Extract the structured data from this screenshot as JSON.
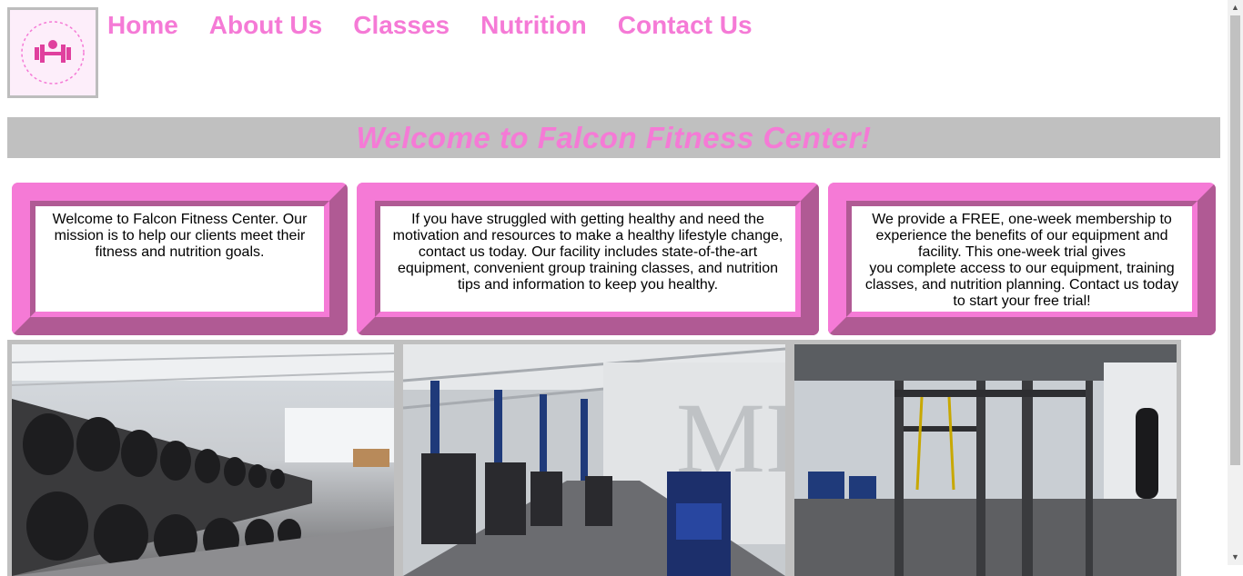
{
  "logo": {
    "alt_text": "FALCON FITNESS CENTER"
  },
  "nav": {
    "items": [
      "Home",
      "About Us",
      "Classes",
      "Nutrition",
      "Contact Us"
    ]
  },
  "banner": {
    "title": "Welcome to Falcon Fitness Center!"
  },
  "boxes": [
    {
      "text": "Welcome to Falcon Fitness Center. Our mission is to help our clients meet their fitness and nutrition goals."
    },
    {
      "text": "If you have struggled with getting healthy and need the motivation and resources to make a healthy lifestyle change, contact us today. Our facility includes state-of-the-art equipment, convenient group training classes, and nutrition tips and information to keep you healthy."
    },
    {
      "text_lines": [
        "We provide a FREE, one-week membership to experience the benefits of our equipment and facility. This one-week trial gives",
        "you complete access to our equipment, training classes, and nutrition planning. Contact us today to start your free trial!"
      ]
    }
  ],
  "photos": [
    {
      "subject": "dumbbell rack in gym"
    },
    {
      "subject": "row of weight machines"
    },
    {
      "subject": "functional training rig with punching bag"
    }
  ],
  "colors": {
    "accent_pink": "#f57ad6",
    "dark_pink": "#b05a94",
    "banner_gray": "#c0c0c0",
    "logo_bg": "#fdeefa"
  },
  "icons": {
    "scroll_up": "scroll-up-arrow-icon",
    "scroll_down": "scroll-down-arrow-icon"
  }
}
